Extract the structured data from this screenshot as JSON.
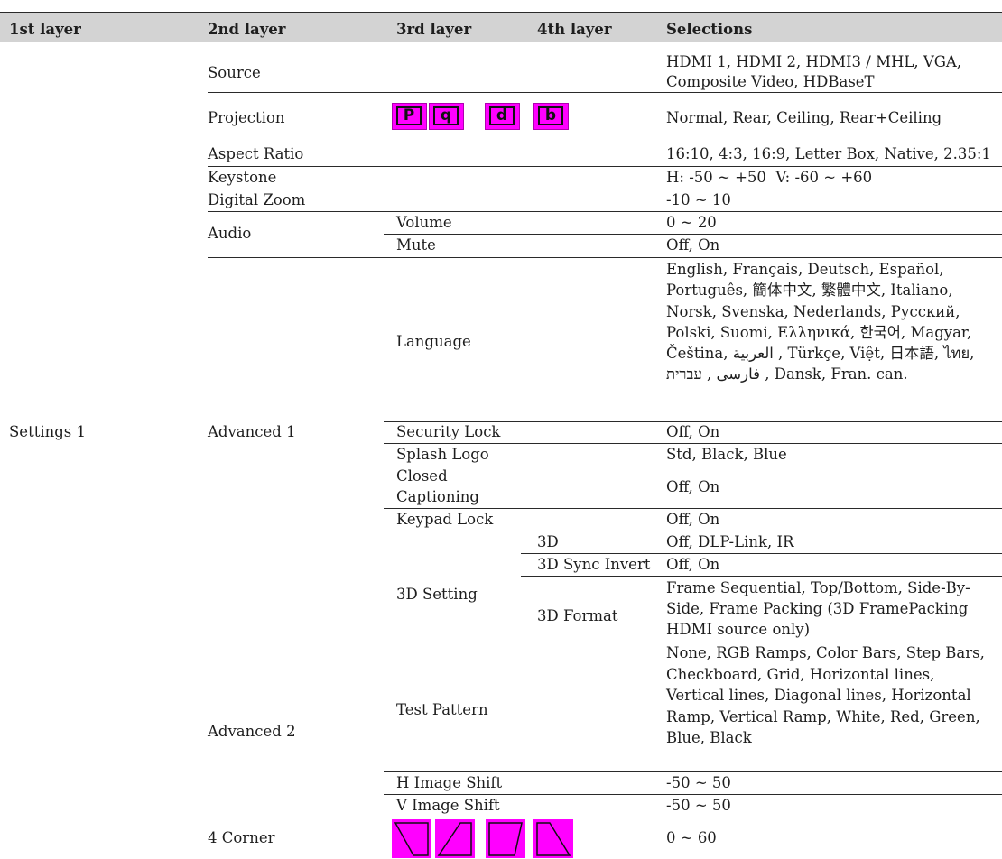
{
  "header": {
    "col1": "1st layer",
    "col2": "2nd layer",
    "col3": "3rd layer",
    "col4": "4th layer",
    "col5": "Selections"
  },
  "rows": {
    "settings1": "Settings 1",
    "source": {
      "label": "Source",
      "sel": "HDMI 1, HDMI 2, HDMI3 / MHL, VGA, Composite Video, HDBaseT"
    },
    "projection": {
      "label": "Projection",
      "sel": "Normal, Rear, Ceiling, Rear+Ceiling",
      "icons": [
        "P",
        "q",
        "d",
        "b"
      ]
    },
    "aspect": {
      "label": "Aspect Ratio",
      "sel": "16:10, 4:3, 16:9, Letter Box, Native, 2.35:1"
    },
    "keystone": {
      "label": "Keystone",
      "sel": "H: -50 ~ +50  V: -60 ~ +60"
    },
    "zoom": {
      "label": "Digital Zoom",
      "sel": "-10 ~ 10"
    },
    "audio": {
      "label": "Audio",
      "volume": {
        "label": "Volume",
        "sel": "0 ~ 20"
      },
      "mute": {
        "label": "Mute",
        "sel": "Off, On"
      }
    },
    "advanced1": {
      "label": "Advanced 1",
      "language": {
        "label": "Language",
        "sel": "English, Français, Deutsch, Español, Português, 簡体中文, 繁體中文, Italiano, Norsk, Svenska, Nederlands, Русский, Polski, Suomi, Ελληνικά, 한국어, Magyar, Čeština, العربية , Türkçe, Việt, 日本語, ไทย, فارسی , עברית , Dansk, Fran. can."
      },
      "security": {
        "label": "Security Lock",
        "sel": "Off, On"
      },
      "splash": {
        "label": "Splash Logo",
        "sel": "Std, Black, Blue"
      },
      "cc": {
        "label1": "Closed",
        "label2": "Captioning",
        "sel": "Off, On"
      },
      "keypad": {
        "label": "Keypad Lock",
        "sel": "Off, On"
      },
      "setting3d": {
        "label": "3D Setting",
        "d3": {
          "label": "3D",
          "sel": "Off, DLP-Link, IR"
        },
        "sync": {
          "label": "3D Sync Invert",
          "sel": "Off, On"
        },
        "format": {
          "label": "3D Format",
          "sel": "Frame Sequential, Top/Bottom, Side-By-Side, Frame Packing (3D FramePacking HDMI source only)"
        }
      }
    },
    "advanced2": {
      "label": "Advanced 2",
      "test": {
        "label": "Test Pattern",
        "sel": "None, RGB Ramps, Color Bars, Step Bars, Checkboard, Grid, Horizontal lines, Vertical lines, Diagonal lines, Horizontal Ramp, Vertical Ramp, White, Red, Green, Blue, Black"
      },
      "hshift": {
        "label": "H Image Shift",
        "sel": "-50 ~ 50"
      },
      "vshift": {
        "label": "V Image Shift",
        "sel": "-50 ~ 50"
      }
    },
    "corner": {
      "label": "4 Corner",
      "sel": "0 ~ 60"
    }
  },
  "colors": {
    "highlight": "#ff00ff",
    "header_bg": "#d3d3d3"
  }
}
